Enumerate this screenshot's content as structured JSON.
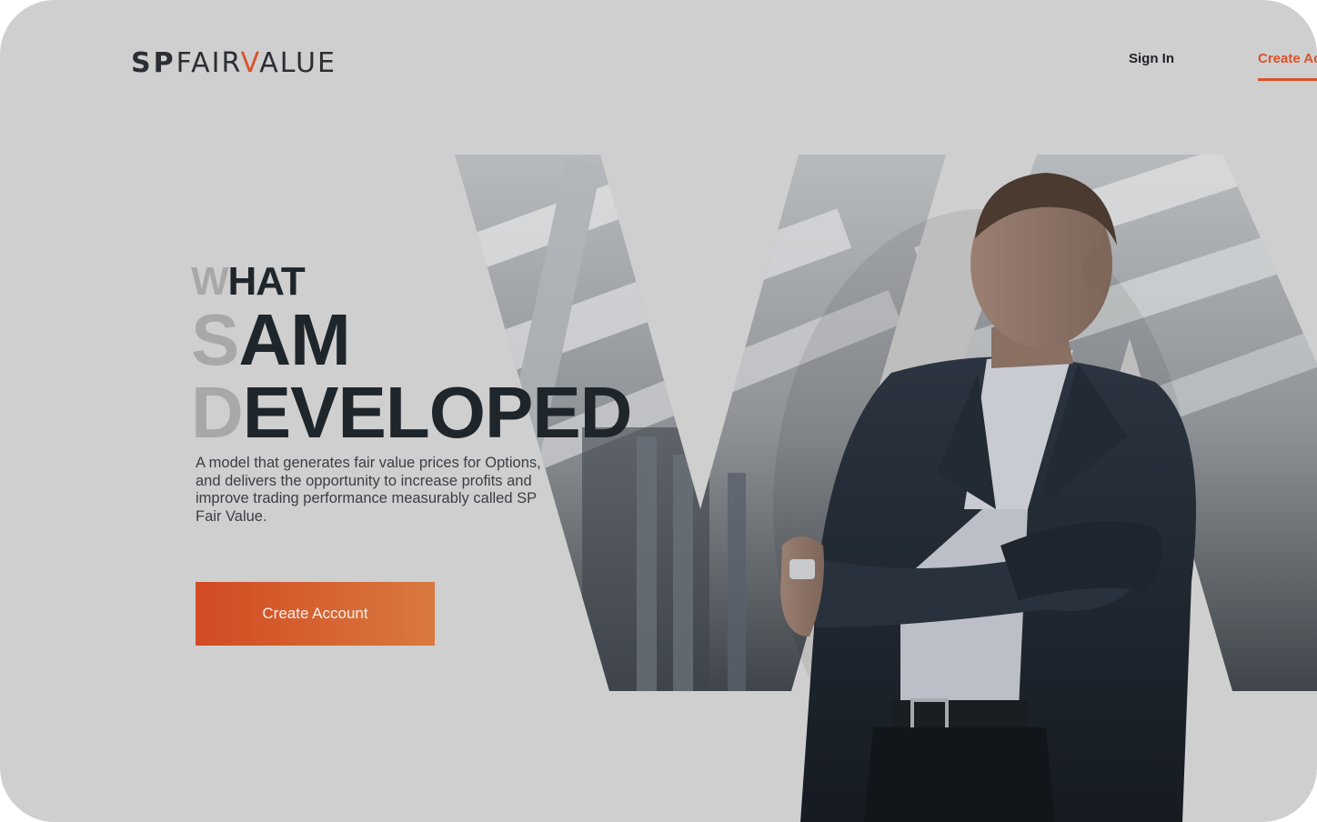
{
  "brand": {
    "logo_sp": "SP",
    "logo_fair": "FAIR",
    "logo_v": "V",
    "logo_alue": "ALUE",
    "accent_color": "#d9532a"
  },
  "nav": {
    "sign_in": "Sign In",
    "create_account": "Create Ac"
  },
  "hero": {
    "line1_first": "W",
    "line1_rest": "HAT",
    "line2_first": "S",
    "line2_rest": "AM",
    "line3_first": "D",
    "line3_rest": "EVELOPED",
    "description": "A model that generates fair value prices for Options, and delivers the opportunity to increase profits and improve trading performance measurably called SP Fair Value.",
    "cta_label": "Create Account"
  },
  "icons": [
    "hero-photo-illustration"
  ]
}
